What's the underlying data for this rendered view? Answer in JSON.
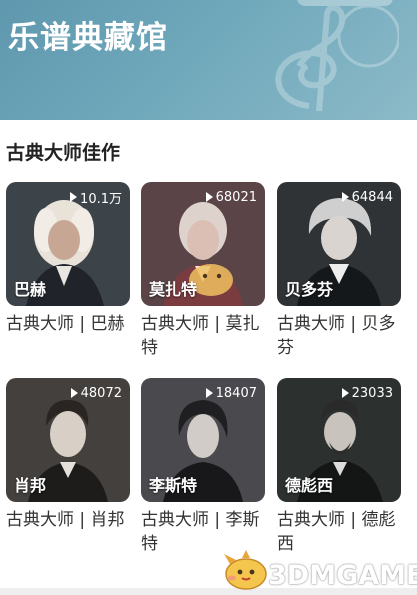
{
  "header": {
    "title": "乐谱典藏馆"
  },
  "section": {
    "title": "古典大师佳作"
  },
  "cards": [
    {
      "name": "巴赫",
      "plays": "10.1万",
      "caption": "古典大师 | 巴赫",
      "bg": "#3d4449"
    },
    {
      "name": "莫扎特",
      "plays": "68021",
      "caption": "古典大师 | 莫扎特",
      "bg": "#5a4447"
    },
    {
      "name": "贝多芬",
      "plays": "64844",
      "caption": "古典大师 | 贝多芬",
      "bg": "#2f3336"
    },
    {
      "name": "肖邦",
      "plays": "48072",
      "caption": "古典大师 | 肖邦",
      "bg": "#43403e"
    },
    {
      "name": "李斯特",
      "plays": "18407",
      "caption": "古典大师 | 李斯特",
      "bg": "#4a4a4e"
    },
    {
      "name": "德彪西",
      "plays": "23033",
      "caption": "古典大师 | 德彪西",
      "bg": "#2c302f"
    }
  ],
  "watermark": {
    "text": "3DMGAME"
  }
}
